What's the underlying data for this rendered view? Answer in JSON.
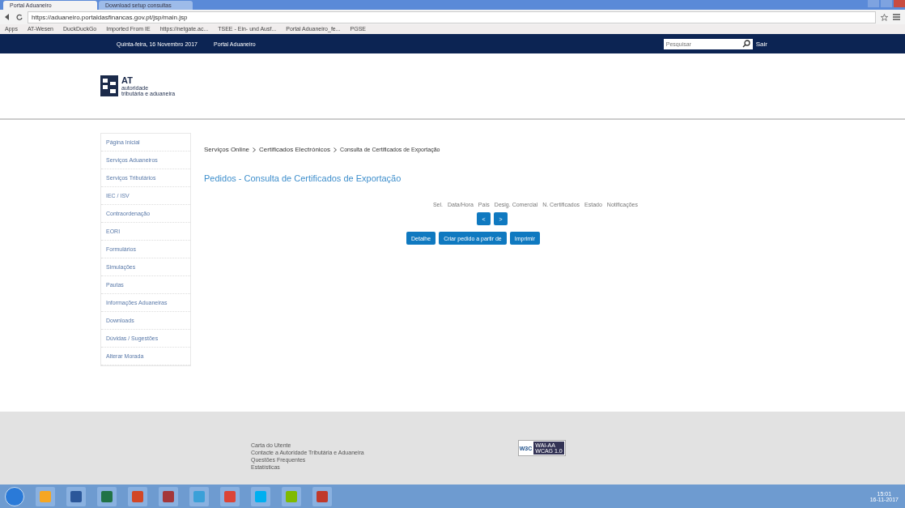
{
  "browser": {
    "tabs": [
      {
        "label": "Portal Aduaneiro",
        "selected": true
      },
      {
        "label": "Download setup consultas",
        "selected": false
      }
    ],
    "url": "https://aduaneiro.portaldasfinancas.gov.pt/jsp/main.jsp",
    "bookmarks": [
      "Apps",
      "AT-Wesen",
      "DuckDuckGo",
      "Imported From IE",
      "https://netgate.ac...",
      "TSEE - Ein- und Ausf...",
      "Portal Aduaneiro_fe...",
      "PGSE"
    ]
  },
  "header": {
    "date": "Quinta-feira, 16 Novembro 2017",
    "site": "Portal Aduaneiro",
    "search": {
      "placeholder": "Pesquisar"
    },
    "logout": "Sair"
  },
  "logo": {
    "short": "AT",
    "line1": "autoridade",
    "line2": "tributária e aduaneira"
  },
  "sidebar": {
    "items": [
      "Página Inicial",
      "Serviços Aduaneiros",
      "Serviços Tributários",
      "IEC / ISV",
      "Contraordenação",
      "EORI",
      "Formulários",
      "Simulações",
      "Pautas",
      "Informações Aduaneiras",
      "Downloads",
      "Dúvidas / Sugestões",
      "Alterar Morada"
    ]
  },
  "breadcrumb": [
    "Serviços Online",
    "Certificados Electrónicos",
    "Consulta de Certificados de Exportação"
  ],
  "title": "Pedidos - Consulta de Certificados de Exportação",
  "table": {
    "columns": [
      "Sel.",
      "Data/Hora",
      "País",
      "Desig. Comercial",
      "N. Certificados",
      "Estado",
      "Notificações"
    ]
  },
  "pager": [
    "<",
    ">"
  ],
  "buttons": [
    "Detalhe",
    "Criar pedido a partir de",
    "Imprimir"
  ],
  "footer": {
    "links": [
      "Carta do Utente",
      "Contacte a Autoridade Tributária e Aduaneira",
      "Questões Frequentes",
      "Estatísticas"
    ],
    "badge": {
      "left": "W3C",
      "top": "WAI-AA",
      "bottom": "WCAG 1.0"
    }
  },
  "taskbar": {
    "time": "15:01",
    "date": "16-11-2017"
  }
}
